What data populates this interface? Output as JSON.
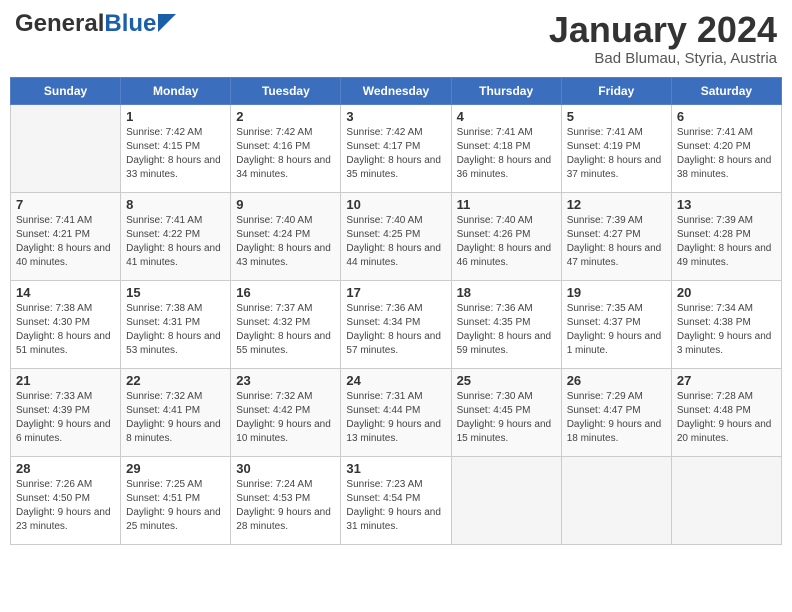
{
  "header": {
    "logo_general": "General",
    "logo_blue": "Blue",
    "month_title": "January 2024",
    "subtitle": "Bad Blumau, Styria, Austria"
  },
  "days_of_week": [
    "Sunday",
    "Monday",
    "Tuesday",
    "Wednesday",
    "Thursday",
    "Friday",
    "Saturday"
  ],
  "weeks": [
    [
      {
        "day": "",
        "empty": true
      },
      {
        "day": "1",
        "sunrise": "7:42 AM",
        "sunset": "4:15 PM",
        "daylight": "8 hours and 33 minutes."
      },
      {
        "day": "2",
        "sunrise": "7:42 AM",
        "sunset": "4:16 PM",
        "daylight": "8 hours and 34 minutes."
      },
      {
        "day": "3",
        "sunrise": "7:42 AM",
        "sunset": "4:17 PM",
        "daylight": "8 hours and 35 minutes."
      },
      {
        "day": "4",
        "sunrise": "7:41 AM",
        "sunset": "4:18 PM",
        "daylight": "8 hours and 36 minutes."
      },
      {
        "day": "5",
        "sunrise": "7:41 AM",
        "sunset": "4:19 PM",
        "daylight": "8 hours and 37 minutes."
      },
      {
        "day": "6",
        "sunrise": "7:41 AM",
        "sunset": "4:20 PM",
        "daylight": "8 hours and 38 minutes."
      }
    ],
    [
      {
        "day": "7",
        "sunrise": "7:41 AM",
        "sunset": "4:21 PM",
        "daylight": "8 hours and 40 minutes."
      },
      {
        "day": "8",
        "sunrise": "7:41 AM",
        "sunset": "4:22 PM",
        "daylight": "8 hours and 41 minutes."
      },
      {
        "day": "9",
        "sunrise": "7:40 AM",
        "sunset": "4:24 PM",
        "daylight": "8 hours and 43 minutes."
      },
      {
        "day": "10",
        "sunrise": "7:40 AM",
        "sunset": "4:25 PM",
        "daylight": "8 hours and 44 minutes."
      },
      {
        "day": "11",
        "sunrise": "7:40 AM",
        "sunset": "4:26 PM",
        "daylight": "8 hours and 46 minutes."
      },
      {
        "day": "12",
        "sunrise": "7:39 AM",
        "sunset": "4:27 PM",
        "daylight": "8 hours and 47 minutes."
      },
      {
        "day": "13",
        "sunrise": "7:39 AM",
        "sunset": "4:28 PM",
        "daylight": "8 hours and 49 minutes."
      }
    ],
    [
      {
        "day": "14",
        "sunrise": "7:38 AM",
        "sunset": "4:30 PM",
        "daylight": "8 hours and 51 minutes."
      },
      {
        "day": "15",
        "sunrise": "7:38 AM",
        "sunset": "4:31 PM",
        "daylight": "8 hours and 53 minutes."
      },
      {
        "day": "16",
        "sunrise": "7:37 AM",
        "sunset": "4:32 PM",
        "daylight": "8 hours and 55 minutes."
      },
      {
        "day": "17",
        "sunrise": "7:36 AM",
        "sunset": "4:34 PM",
        "daylight": "8 hours and 57 minutes."
      },
      {
        "day": "18",
        "sunrise": "7:36 AM",
        "sunset": "4:35 PM",
        "daylight": "8 hours and 59 minutes."
      },
      {
        "day": "19",
        "sunrise": "7:35 AM",
        "sunset": "4:37 PM",
        "daylight": "9 hours and 1 minute."
      },
      {
        "day": "20",
        "sunrise": "7:34 AM",
        "sunset": "4:38 PM",
        "daylight": "9 hours and 3 minutes."
      }
    ],
    [
      {
        "day": "21",
        "sunrise": "7:33 AM",
        "sunset": "4:39 PM",
        "daylight": "9 hours and 6 minutes."
      },
      {
        "day": "22",
        "sunrise": "7:32 AM",
        "sunset": "4:41 PM",
        "daylight": "9 hours and 8 minutes."
      },
      {
        "day": "23",
        "sunrise": "7:32 AM",
        "sunset": "4:42 PM",
        "daylight": "9 hours and 10 minutes."
      },
      {
        "day": "24",
        "sunrise": "7:31 AM",
        "sunset": "4:44 PM",
        "daylight": "9 hours and 13 minutes."
      },
      {
        "day": "25",
        "sunrise": "7:30 AM",
        "sunset": "4:45 PM",
        "daylight": "9 hours and 15 minutes."
      },
      {
        "day": "26",
        "sunrise": "7:29 AM",
        "sunset": "4:47 PM",
        "daylight": "9 hours and 18 minutes."
      },
      {
        "day": "27",
        "sunrise": "7:28 AM",
        "sunset": "4:48 PM",
        "daylight": "9 hours and 20 minutes."
      }
    ],
    [
      {
        "day": "28",
        "sunrise": "7:26 AM",
        "sunset": "4:50 PM",
        "daylight": "9 hours and 23 minutes."
      },
      {
        "day": "29",
        "sunrise": "7:25 AM",
        "sunset": "4:51 PM",
        "daylight": "9 hours and 25 minutes."
      },
      {
        "day": "30",
        "sunrise": "7:24 AM",
        "sunset": "4:53 PM",
        "daylight": "9 hours and 28 minutes."
      },
      {
        "day": "31",
        "sunrise": "7:23 AM",
        "sunset": "4:54 PM",
        "daylight": "9 hours and 31 minutes."
      },
      {
        "day": "",
        "empty": true
      },
      {
        "day": "",
        "empty": true
      },
      {
        "day": "",
        "empty": true
      }
    ]
  ],
  "labels": {
    "sunrise": "Sunrise:",
    "sunset": "Sunset:",
    "daylight": "Daylight:"
  }
}
